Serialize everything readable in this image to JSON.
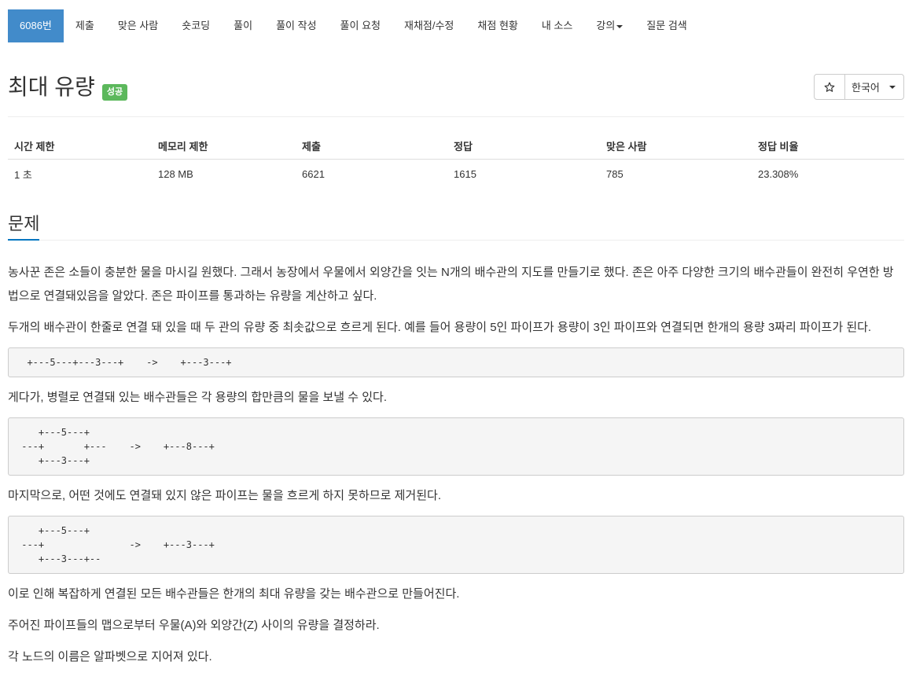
{
  "colors": {
    "accent": "#428bca",
    "success": "#5cb85c",
    "headline_underline": "#0076c0",
    "text": "#333333"
  },
  "nav": {
    "tabs": [
      {
        "label": "6086번",
        "active": true
      },
      {
        "label": "제출"
      },
      {
        "label": "맞은 사람"
      },
      {
        "label": "숏코딩"
      },
      {
        "label": "풀이"
      },
      {
        "label": "풀이 작성"
      },
      {
        "label": "풀이 요청"
      },
      {
        "label": "재채점/수정"
      },
      {
        "label": "채점 현황"
      },
      {
        "label": "내 소스"
      },
      {
        "label": "강의",
        "dropdown": true,
        "icon": "caret-down-icon"
      },
      {
        "label": "질문 검색"
      }
    ]
  },
  "header": {
    "title": "최대 유량",
    "status_badge": "성공",
    "favorite_button": {
      "icon": "star-icon"
    },
    "language_select": {
      "selected": "한국어",
      "icon": "caret-down-icon"
    }
  },
  "info_table": {
    "headers": [
      "시간 제한",
      "메모리 제한",
      "제출",
      "정답",
      "맞은 사람",
      "정답 비율"
    ],
    "values": [
      "1 초",
      "128 MB",
      "6621",
      "1615",
      "785",
      "23.308%"
    ]
  },
  "problem": {
    "heading": "문제",
    "description": [
      {
        "paragraph": "농사꾼 존은 소들이 충분한 물을 마시길 원했다. 그래서 농장에서 우물에서 외양간을 잇는 N개의 배수관의 지도를 만들기로 했다. 존은 아주 다양한 크기의 배수관들이 완전히 우연한 방법으로 연결돼있음을 알았다. 존은 파이프를 통과하는 유량을 계산하고 싶다."
      },
      {
        "paragraph": "두개의 배수관이 한줄로 연결 돼 있을 때 두 관의 유량 중 최솟값으로 흐르게 된다. 예를 들어 용량이 5인 파이프가 용량이 3인 파이프와 연결되면 한개의 용량 3짜리 파이프가 된다."
      },
      {
        "code": "  +---5---+---3---+    ->    +---3---+"
      },
      {
        "paragraph": "게다가, 병렬로 연결돼 있는 배수관들은 각 용량의 합만큼의 물을 보낼 수 있다."
      },
      {
        "code": "    +---5---+\n ---+       +---    ->    +---8---+\n    +---3---+"
      },
      {
        "paragraph": "마지막으로, 어떤 것에도 연결돼 있지 않은 파이프는 물을 흐르게 하지 못하므로 제거된다."
      },
      {
        "code": "    +---5---+\n ---+               ->    +---3---+\n    +---3---+--"
      },
      {
        "paragraph": "이로 인해 복잡하게 연결된 모든 배수관들은 한개의 최대 유량을 갖는 배수관으로 만들어진다."
      },
      {
        "paragraph": "주어진 파이프들의 맵으로부터 우물(A)와 외양간(Z) 사이의 유량을 결정하라."
      },
      {
        "paragraph": "각 노드의 이름은 알파벳으로 지어져 있다."
      }
    ]
  }
}
